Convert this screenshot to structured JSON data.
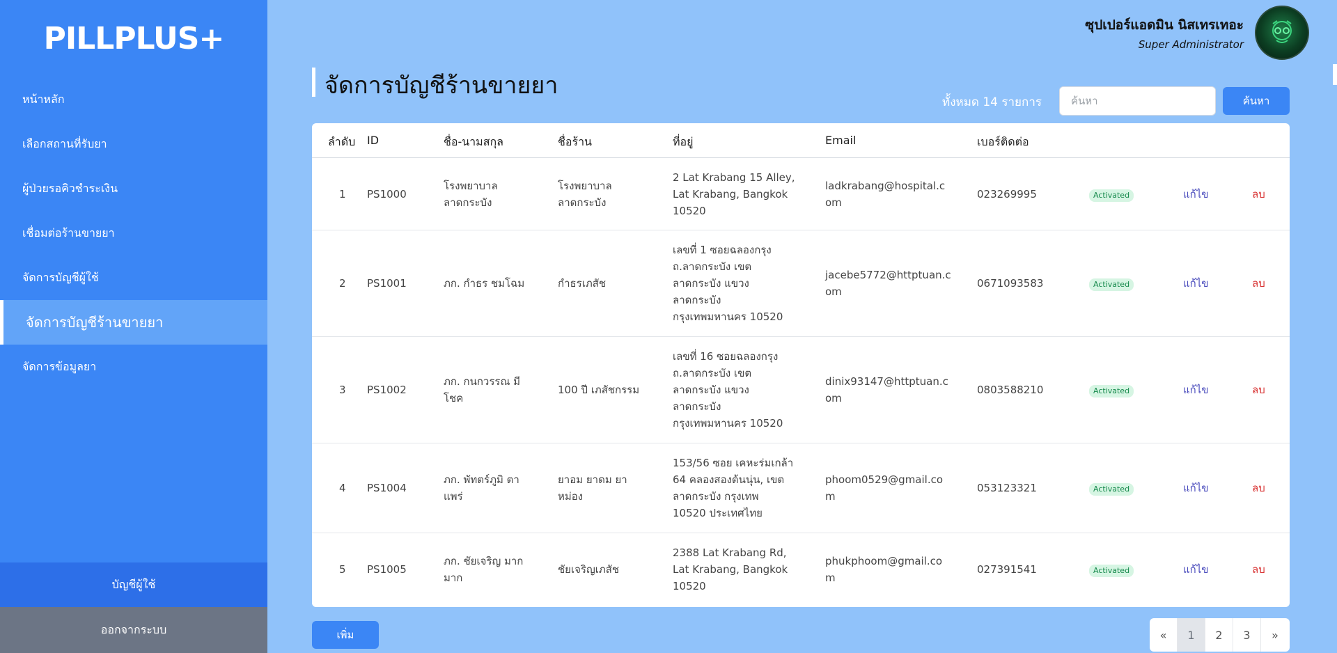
{
  "app": {
    "logo": "PILLPLUS+"
  },
  "sidebar": {
    "items": [
      {
        "label": "หน้าหลัก"
      },
      {
        "label": "เลือกสถานที่รับยา"
      },
      {
        "label": "ผู้ป่วยรอคิวชำระเงิน"
      },
      {
        "label": "เชื่อมต่อร้านขายยา"
      },
      {
        "label": "จัดการบัญชีผู้ใช้"
      },
      {
        "label": "จัดการบัญชีร้านขายยา",
        "active": true
      },
      {
        "label": "จัดการข้อมูลยา"
      }
    ],
    "account_label": "บัญชีผู้ใช้",
    "logout_label": "ออกจากระบบ"
  },
  "header": {
    "user_name": "ซุปเปอร์แอดมิน นิสเทรเทอะ",
    "user_role": "Super Administrator",
    "avatar_icon": "avatar-icon"
  },
  "page": {
    "title": "จัดการบัญชีร้านขายยา",
    "total_text": "ทั้งหมด 14 รายการ",
    "search_placeholder": "ค้นหา",
    "search_button": "ค้นหา",
    "add_button": "เพิ่ม"
  },
  "table": {
    "headers": [
      "ลำดับ",
      "ID",
      "ชื่อ-นามสกุล",
      "ชื่อร้าน",
      "ที่อยู่",
      "Email",
      "เบอร์ติดต่อ"
    ],
    "rows": [
      {
        "no": "1",
        "id": "PS1000",
        "name": [
          "โรงพยาบาล",
          "ลาดกระบัง"
        ],
        "shop": [
          "โรงพยาบาล",
          "ลาดกระบัง"
        ],
        "address": [
          "2 Lat Krabang 15 Alley,",
          "Lat Krabang, Bangkok",
          "10520"
        ],
        "email": [
          "ladkrabang@hospital.c",
          "om"
        ],
        "phone": "023269995",
        "status": "Activated",
        "edit": "แก้ไข",
        "delete": "ลบ"
      },
      {
        "no": "2",
        "id": "PS1001",
        "name": [
          "ภก. กำธร ชมโฉม"
        ],
        "shop": [
          "กำธรเภสัช"
        ],
        "address": [
          "เลขที่ 1 ซอยฉลองกรุง",
          "ถ.ลาดกระบัง เขต",
          "ลาดกระบัง แขวง",
          "ลาดกระบัง",
          "กรุงเทพมหานคร 10520"
        ],
        "email": [
          "jacebe5772@httptuan.c",
          "om"
        ],
        "phone": "0671093583",
        "status": "Activated",
        "edit": "แก้ไข",
        "delete": "ลบ"
      },
      {
        "no": "3",
        "id": "PS1002",
        "name": [
          "ภก. กนกวรรณ มี",
          "โชค"
        ],
        "shop": [
          "100 ปี เภสัชกรรม"
        ],
        "address": [
          "เลขที่ 16 ซอยฉลองกรุง",
          "ถ.ลาดกระบัง เขต",
          "ลาดกระบัง แขวง",
          "ลาดกระบัง",
          "กรุงเทพมหานคร 10520"
        ],
        "email": [
          "dinix93147@httptuan.c",
          "om"
        ],
        "phone": "0803588210",
        "status": "Activated",
        "edit": "แก้ไข",
        "delete": "ลบ"
      },
      {
        "no": "4",
        "id": "PS1004",
        "name": [
          "ภก. พัทตร์ภูมิ ตา",
          "แพร่"
        ],
        "shop": [
          "ยาอม ยาดม ยา",
          "หม่อง"
        ],
        "address": [
          "153/56 ซอย เคหะร่มเกล้า",
          "64 คลองสองต้นนุ่น, เขต",
          "ลาดกระบัง กรุงเทพ",
          "10520 ประเทศไทย"
        ],
        "email": [
          "phoom0529@gmail.co",
          "m"
        ],
        "phone": "053123321",
        "status": "Activated",
        "edit": "แก้ไข",
        "delete": "ลบ"
      },
      {
        "no": "5",
        "id": "PS1005",
        "name": [
          "ภก. ชัยเจริญ มาก",
          "มาก"
        ],
        "shop": [
          "ชัยเจริญเภสัช"
        ],
        "address": [
          "2388 Lat Krabang Rd,",
          "Lat Krabang, Bangkok",
          "10520"
        ],
        "email": [
          "phukphoom@gmail.co",
          "m"
        ],
        "phone": "027391541",
        "status": "Activated",
        "edit": "แก้ไข",
        "delete": "ลบ"
      }
    ]
  },
  "pagination": {
    "prev": "«",
    "pages": [
      "1",
      "2",
      "3"
    ],
    "current": "1",
    "next": "»"
  },
  "colors": {
    "sidebar": "#3b86f5",
    "background": "#90c2fa",
    "accent": "#3b86f5",
    "badge_bg": "#d6f5e3",
    "badge_text": "#14884a",
    "edit": "#4b4dbd",
    "delete": "#d83131"
  }
}
